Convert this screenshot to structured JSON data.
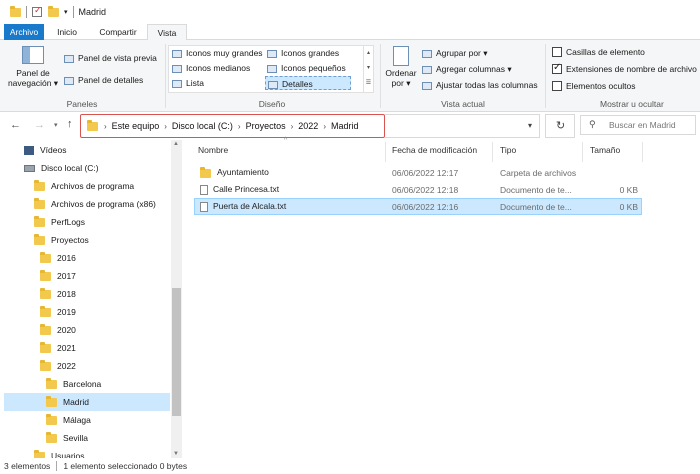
{
  "window": {
    "title": "Madrid"
  },
  "tabs": [
    {
      "label": "Archivo"
    },
    {
      "label": "Inicio"
    },
    {
      "label": "Compartir"
    },
    {
      "label": "Vista"
    }
  ],
  "ribbon": {
    "panes": {
      "nav_pane_line1": "Panel de",
      "nav_pane_line2": "navegación",
      "preview": "Panel de vista previa",
      "details": "Panel de detalles",
      "group_label": "Paneles"
    },
    "layout": {
      "very_large": "Iconos muy grandes",
      "large": "Iconos grandes",
      "medium": "Iconos medianos",
      "small": "Iconos pequeños",
      "list": "Lista",
      "details": "Detalles",
      "group_label": "Diseño"
    },
    "current_view": {
      "sort_line1": "Ordenar",
      "sort_line2": "por",
      "group_by": "Agrupar por",
      "add_columns": "Agregar columnas",
      "fit_columns": "Ajustar todas las columnas",
      "group_label": "Vista actual"
    },
    "show_hide": {
      "item_checkboxes": "Casillas de elemento",
      "item_checkboxes_checked": false,
      "extensions": "Extensiones de nombre de archivo",
      "extensions_checked": true,
      "hidden_items": "Elementos ocultos",
      "hidden_items_checked": false,
      "group_label": "Mostrar u ocultar"
    }
  },
  "breadcrumb": [
    "Este equipo",
    "Disco local (C:)",
    "Proyectos",
    "2022",
    "Madrid"
  ],
  "search": {
    "placeholder": "Buscar en Madrid"
  },
  "sidebar": {
    "items": [
      {
        "label": "Vídeos",
        "icon": "video-icon"
      },
      {
        "label": "Disco local (C:)",
        "icon": "drive-icon"
      },
      {
        "label": "Archivos de programa",
        "icon": "folder-icon"
      },
      {
        "label": "Archivos de programa (x86)",
        "icon": "folder-icon"
      },
      {
        "label": "PerfLogs",
        "icon": "folder-icon"
      },
      {
        "label": "Proyectos",
        "icon": "folder-icon"
      },
      {
        "label": "2016",
        "icon": "folder-icon"
      },
      {
        "label": "2017",
        "icon": "folder-icon"
      },
      {
        "label": "2018",
        "icon": "folder-icon"
      },
      {
        "label": "2019",
        "icon": "folder-icon"
      },
      {
        "label": "2020",
        "icon": "folder-icon"
      },
      {
        "label": "2021",
        "icon": "folder-icon"
      },
      {
        "label": "2022",
        "icon": "folder-icon"
      },
      {
        "label": "Barcelona",
        "icon": "folder-icon"
      },
      {
        "label": "Madrid",
        "icon": "folder-icon",
        "selected": true
      },
      {
        "label": "Málaga",
        "icon": "folder-icon"
      },
      {
        "label": "Sevilla",
        "icon": "folder-icon"
      },
      {
        "label": "Usuarios",
        "icon": "folder-icon"
      }
    ]
  },
  "columns": [
    "Nombre",
    "Fecha de modificación",
    "Tipo",
    "Tamaño"
  ],
  "files": [
    {
      "name": "Ayuntamiento",
      "date": "06/06/2022 12:17",
      "type": "Carpeta de archivos",
      "size": "",
      "icon": "folder-icon"
    },
    {
      "name": "Calle Princesa.txt",
      "date": "06/06/2022 12:18",
      "type": "Documento de te...",
      "size": "0 KB",
      "icon": "text-file-icon"
    },
    {
      "name": "Puerta de Alcala.txt",
      "date": "06/06/2022 12:16",
      "type": "Documento de te...",
      "size": "0 KB",
      "icon": "text-file-icon",
      "selected": true
    }
  ],
  "status": {
    "count": "3 elementos",
    "selection": "1 elemento seleccionado  0 bytes"
  },
  "colors": {
    "accent": "#1979ca",
    "selection": "#cce8ff",
    "highlight_border": "#d9534f"
  }
}
